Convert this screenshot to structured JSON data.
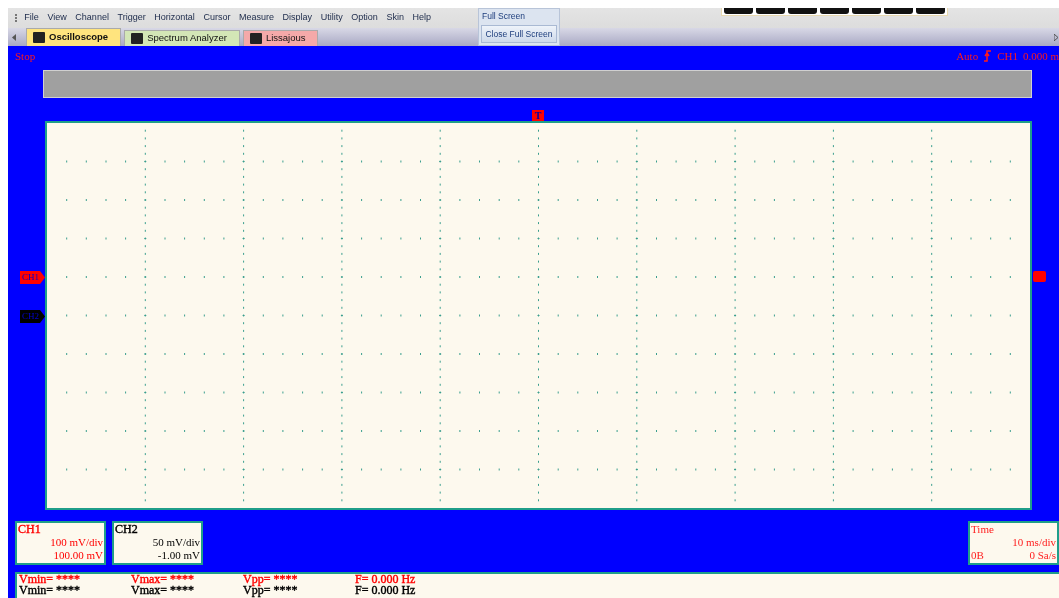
{
  "menu": [
    "File",
    "View",
    "Channel",
    "Trigger",
    "Horizontal",
    "Cursor",
    "Measure",
    "Display",
    "Utility",
    "Option",
    "Skin",
    "Help"
  ],
  "full_screen_group": {
    "title": "Full Screen",
    "button": "Close Full Screen"
  },
  "tabs": [
    {
      "label": "Oscilloscope",
      "selected": true,
      "color": "#ffe47e"
    },
    {
      "label": "Spectrum Analyzer",
      "selected": false,
      "color": "#d3e6b6"
    },
    {
      "label": "Lissajous",
      "selected": false,
      "color": "#f5a9a9"
    }
  ],
  "status": {
    "run_state": "Stop",
    "trigger_mode": "Auto",
    "trigger_source": "CH1",
    "trigger_level": "0.000 m"
  },
  "trigger_marker": "T",
  "channel_markers": [
    {
      "label": "CH1",
      "color": "#ff0000"
    },
    {
      "label": "CH2",
      "color": "#000000"
    }
  ],
  "channels": [
    {
      "name": "CH1",
      "scale": "100 mV/div",
      "offset": "100.00 mV",
      "color": "#ff0000"
    },
    {
      "name": "CH2",
      "scale": "50 mV/div",
      "offset": "-1.00 mV",
      "color": "#000000"
    }
  ],
  "timebase": {
    "label": "Time",
    "scale": "10 ms/div",
    "memory": "0B",
    "rate": "0 Sa/s"
  },
  "measurements": [
    {
      "color": "#ff0000",
      "values": [
        "Vmin= ****",
        "Vmax= ****",
        "Vpp= ****",
        "F= 0.000 Hz"
      ]
    },
    {
      "color": "#000000",
      "values": [
        "Vmin= ****",
        "Vmax= ****",
        "Vpp= ****",
        "F= 0.000 Hz"
      ]
    }
  ]
}
